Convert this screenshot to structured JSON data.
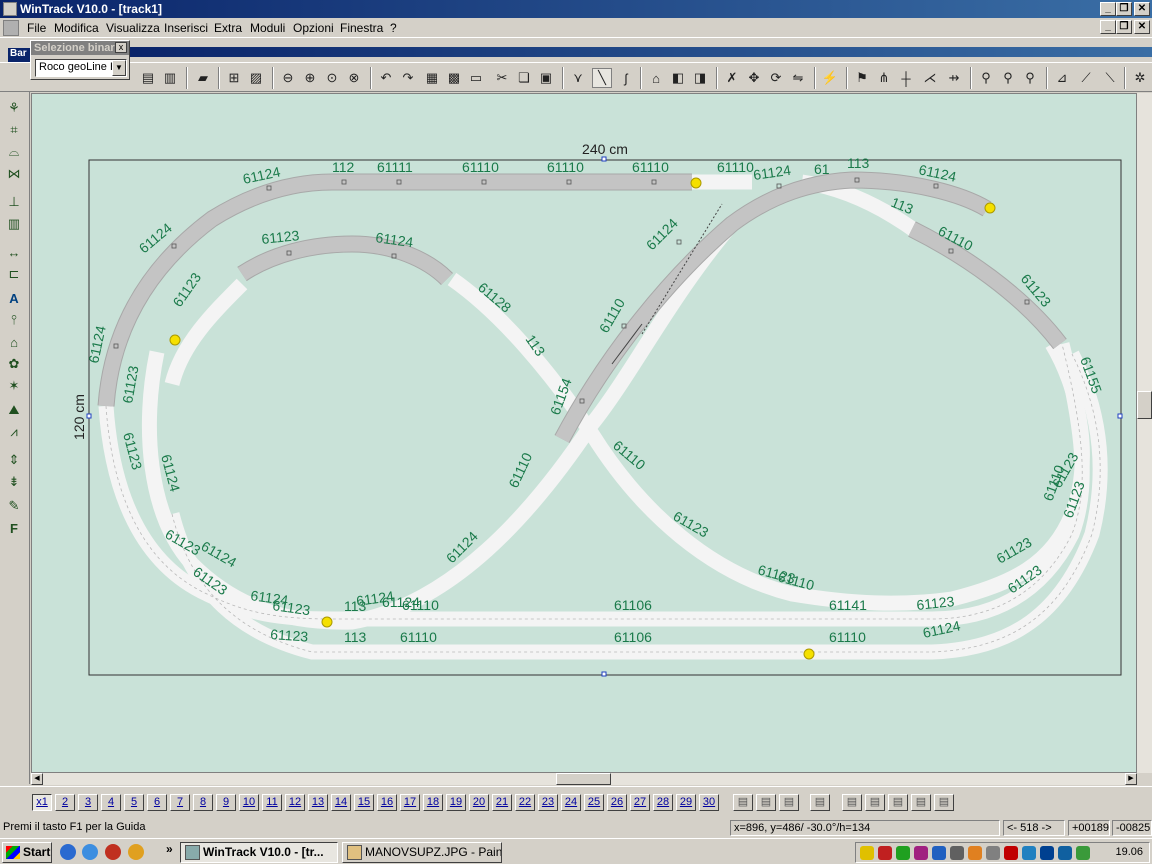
{
  "window": {
    "title": "WinTrack  V10.0 - [track1]",
    "minimize": "_",
    "restore": "❐",
    "close": "✕"
  },
  "menu": [
    "File",
    "Modifica",
    "Visualizza",
    "Inserisci",
    "Extra",
    "Moduli",
    "Opzioni",
    "Finestra",
    "?"
  ],
  "palette": {
    "title": "Selezione binar",
    "selected": "Roco geoLine H",
    "tab_label": "Bar"
  },
  "layout": {
    "width_label": "240 cm",
    "height_label": "120 cm"
  },
  "track_labels": [
    "61124",
    "112",
    "61111",
    "61110",
    "61110",
    "61110",
    "61110",
    "61124",
    "61",
    "113",
    "61124",
    "61124",
    "61123",
    "61124",
    "61123",
    "61128",
    "113",
    "61124",
    "113",
    "61110",
    "61124",
    "61123",
    "61110",
    "61123",
    "61155",
    "61123",
    "61124",
    "61154",
    "61110",
    "61110",
    "61110",
    "61123",
    "61124",
    "61124",
    "61123",
    "61123",
    "61124",
    "61123",
    "61124",
    "61123",
    "113",
    "61124",
    "61110",
    "61106",
    "61141",
    "61123",
    "61123",
    "61123",
    "113",
    "61110",
    "61106",
    "61110",
    "61124",
    "61123",
    "61123",
    "61123",
    "61110"
  ],
  "layers": [
    "x1",
    "2",
    "3",
    "4",
    "5",
    "6",
    "7",
    "8",
    "9",
    "10",
    "11",
    "12",
    "13",
    "14",
    "15",
    "16",
    "17",
    "18",
    "19",
    "20",
    "21",
    "22",
    "23",
    "24",
    "25",
    "26",
    "27",
    "28",
    "29",
    "30"
  ],
  "status": {
    "help": "Premi il tasto F1 per la Guida",
    "coords": "x=896, y=486/ -30.0°/h=134",
    "nav": "<- 518 ->",
    "counter1": "+00189",
    "counter2": "-00825"
  },
  "taskbar": {
    "start": "Start",
    "task1": "WinTrack  V10.0 - [tr...",
    "task2": "MANOVSUPZ.JPG - Paint",
    "clock": "19.06",
    "chevron": "»"
  },
  "colors": {
    "canvas": "#c9e2d8",
    "track_grey": "#bdbdbd",
    "track_white": "#f4f4f4",
    "label_green": "#1a7a4a"
  }
}
